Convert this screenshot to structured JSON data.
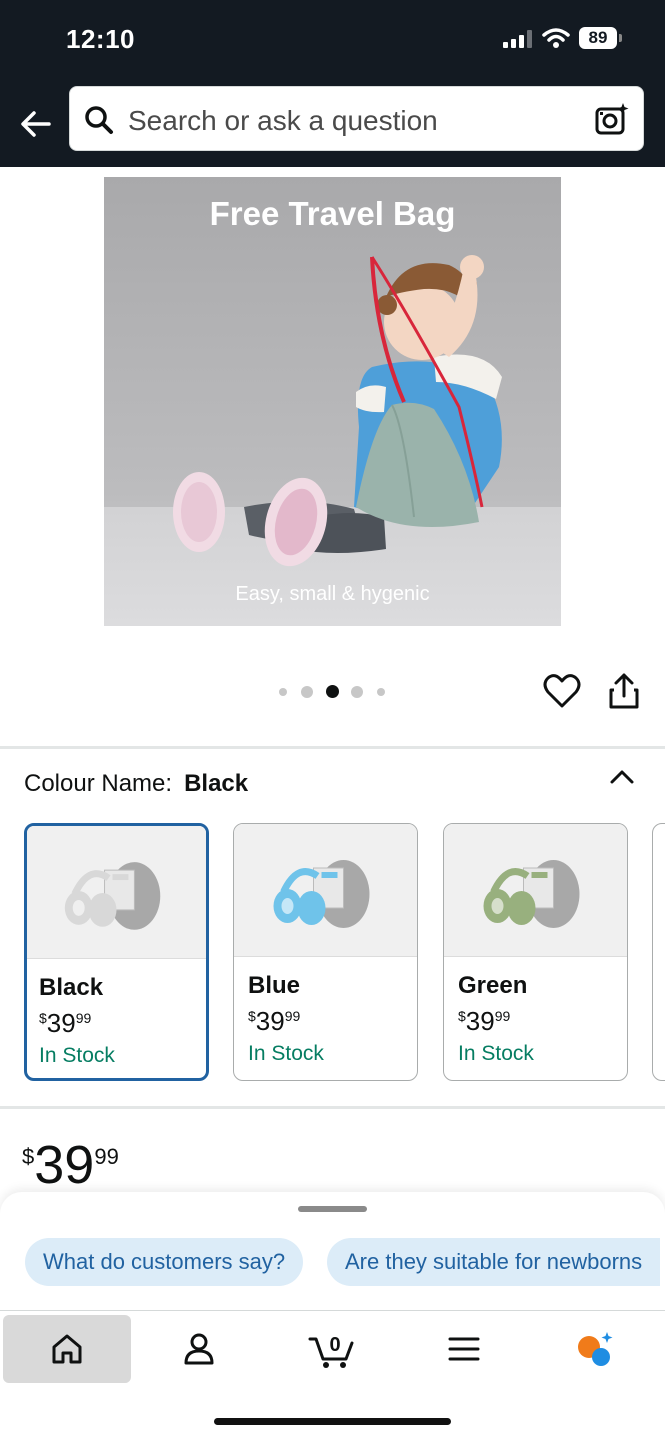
{
  "status_bar": {
    "time": "12:10",
    "battery": "89"
  },
  "search": {
    "placeholder": "Search or ask a question"
  },
  "hero": {
    "title": "Free Travel Bag",
    "subtitle": "Easy, small & hygenic"
  },
  "carousel": {
    "count": 5,
    "active_index": 2
  },
  "colour": {
    "label": "Colour Name:",
    "selected": "Black"
  },
  "swatches": [
    {
      "name": "Black",
      "currency": "$",
      "price_whole": "39",
      "price_fraction": "99",
      "stock": "In Stock",
      "selected": true,
      "band_color": "#d8d8d8"
    },
    {
      "name": "Blue",
      "currency": "$",
      "price_whole": "39",
      "price_fraction": "99",
      "stock": "In Stock",
      "selected": false,
      "band_color": "#6fc3ea"
    },
    {
      "name": "Green",
      "currency": "$",
      "price_whole": "39",
      "price_fraction": "99",
      "stock": "In Stock",
      "selected": false,
      "band_color": "#98b07e"
    }
  ],
  "price": {
    "currency": "$",
    "whole": "39",
    "fraction": "99"
  },
  "chips": [
    "What do customers say?",
    "Are they suitable for newborns"
  ],
  "tabbar": {
    "items": [
      {
        "icon": "home-icon",
        "active": true
      },
      {
        "icon": "account-icon",
        "active": false
      },
      {
        "icon": "cart-icon",
        "active": false,
        "badge": "0"
      },
      {
        "icon": "menu-icon",
        "active": false
      },
      {
        "icon": "rufus-assistant-icon",
        "active": false
      }
    ]
  },
  "colors": {
    "header_bg": "#131a22",
    "accent_blue": "#2162a1",
    "stock_green": "#067d62",
    "chip_bg": "#dcecf8"
  }
}
